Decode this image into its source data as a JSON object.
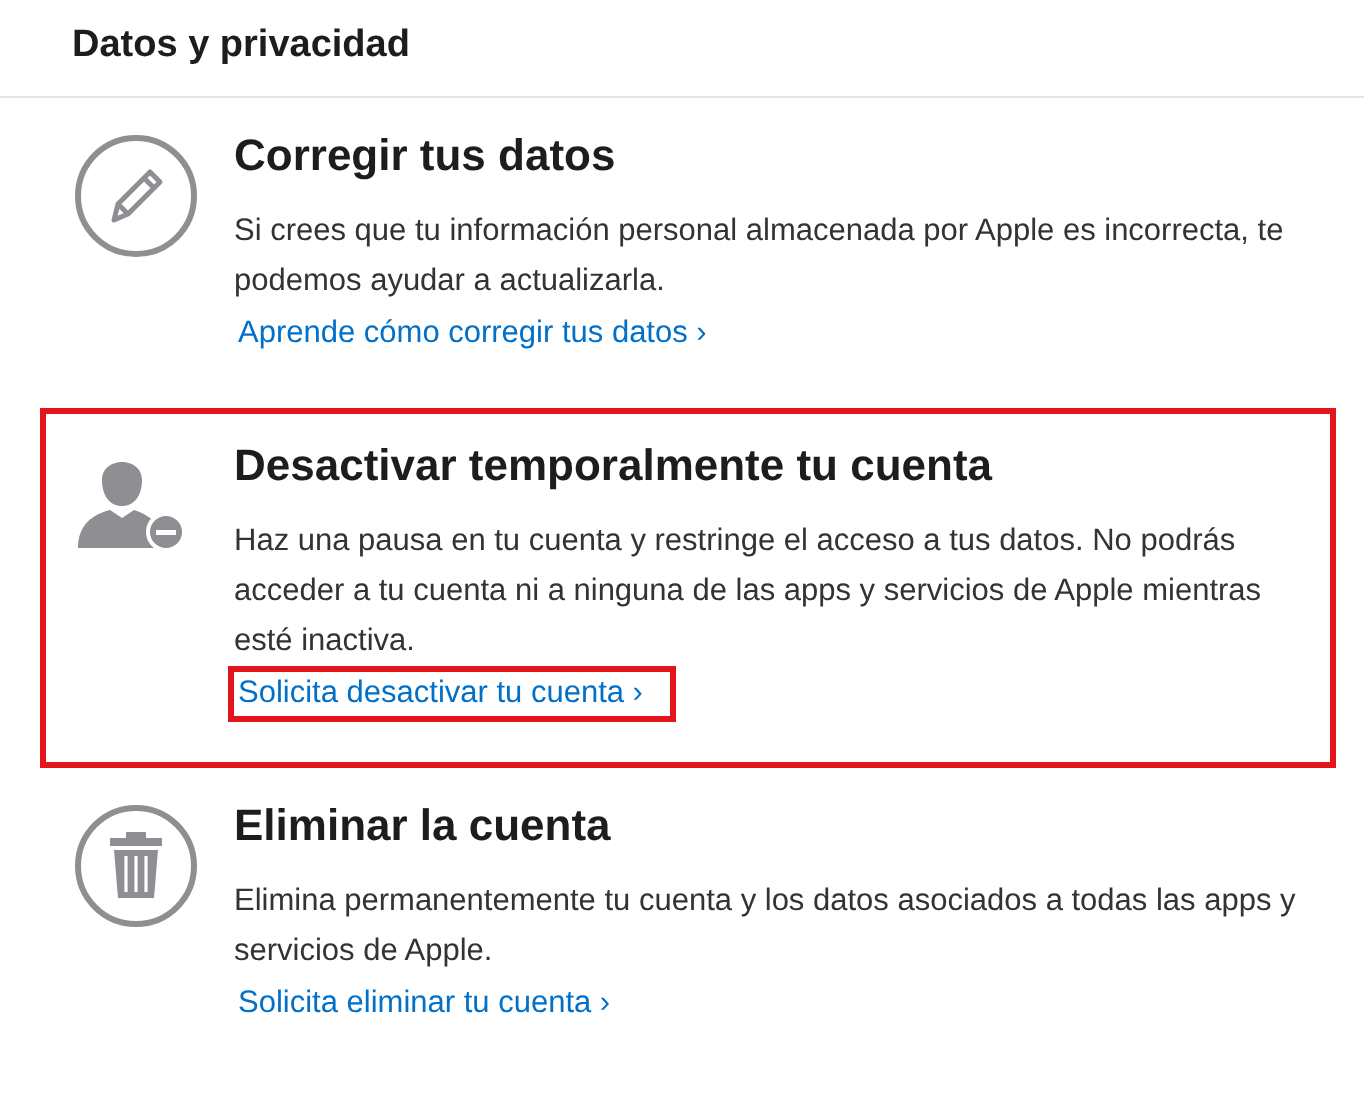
{
  "header": {
    "title": "Datos y privacidad"
  },
  "sections": [
    {
      "kind": "edit",
      "title": "Corregir tus datos",
      "body": "Si crees que tu información personal almacenada por Apple es incorrecta, te podemos ayudar a actualizarla.",
      "link": "Aprende cómo corregir tus datos ›",
      "highlighted": false,
      "link_highlighted": false
    },
    {
      "kind": "deactivate",
      "title": "Desactivar temporalmente tu cuenta",
      "body": "Haz una pausa en tu cuenta y restringe el acceso a tus datos. No podrás acceder a tu cuenta ni a ninguna de las apps y servicios de Apple mientras esté inactiva.",
      "link": "Solicita desactivar tu cuenta ›",
      "highlighted": true,
      "link_highlighted": true
    },
    {
      "kind": "delete",
      "title": "Eliminar la cuenta",
      "body": "Elimina permanentemente tu cuenta y los datos asociados a todas las apps y servicios de Apple.",
      "link": "Solicita eliminar tu cuenta ›",
      "highlighted": false,
      "link_highlighted": false
    }
  ]
}
